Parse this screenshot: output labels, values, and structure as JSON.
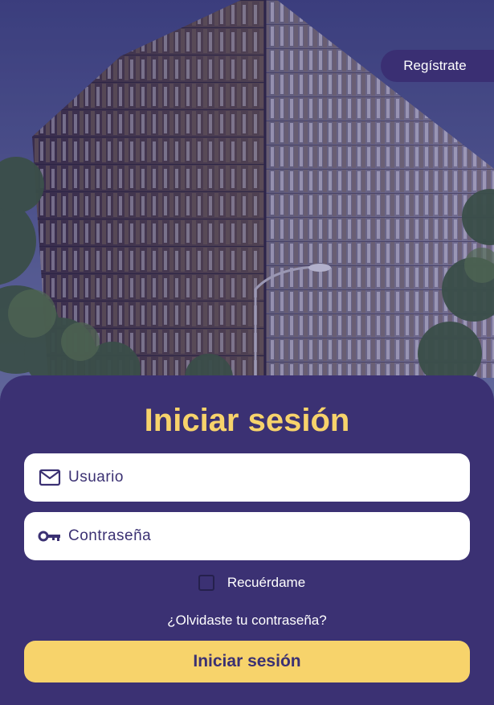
{
  "header": {
    "register_label": "Regístrate"
  },
  "login": {
    "title": "Iniciar sesión",
    "username": {
      "placeholder": "Usuario",
      "value": "",
      "icon": "mail-icon"
    },
    "password": {
      "placeholder": "Contraseña",
      "value": "",
      "icon": "key-icon"
    },
    "remember_label": "Recuérdame",
    "remember_checked": false,
    "forgot_label": "¿Olvidaste tu contraseña?",
    "submit_label": "Iniciar sesión"
  },
  "colors": {
    "primary": "#3b3173",
    "accent": "#f7d36b",
    "text_light": "#ffffff"
  }
}
